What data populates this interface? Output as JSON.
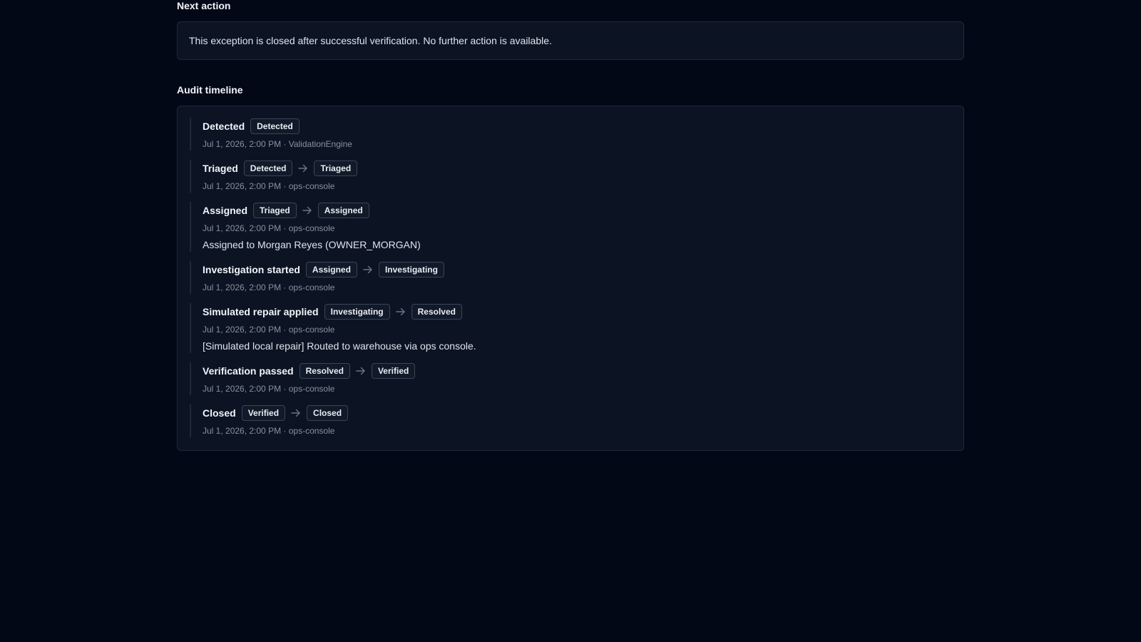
{
  "next_action": {
    "title": "Next action",
    "message": "This exception is closed after successful verification. No further action is available."
  },
  "audit": {
    "title": "Audit timeline",
    "events": [
      {
        "title": "Detected",
        "from": "",
        "to": "Detected",
        "meta": "Jul 1, 2026, 2:00 PM · ValidationEngine",
        "note": ""
      },
      {
        "title": "Triaged",
        "from": "Detected",
        "to": "Triaged",
        "meta": "Jul 1, 2026, 2:00 PM · ops-console",
        "note": ""
      },
      {
        "title": "Assigned",
        "from": "Triaged",
        "to": "Assigned",
        "meta": "Jul 1, 2026, 2:00 PM · ops-console",
        "note": "Assigned to Morgan Reyes (OWNER_MORGAN)"
      },
      {
        "title": "Investigation started",
        "from": "Assigned",
        "to": "Investigating",
        "meta": "Jul 1, 2026, 2:00 PM · ops-console",
        "note": ""
      },
      {
        "title": "Simulated repair applied",
        "from": "Investigating",
        "to": "Resolved",
        "meta": "Jul 1, 2026, 2:00 PM · ops-console",
        "note": "[Simulated local repair] Routed to warehouse via ops console."
      },
      {
        "title": "Verification passed",
        "from": "Resolved",
        "to": "Verified",
        "meta": "Jul 1, 2026, 2:00 PM · ops-console",
        "note": ""
      },
      {
        "title": "Closed",
        "from": "Verified",
        "to": "Closed",
        "meta": "Jul 1, 2026, 2:00 PM · ops-console",
        "note": ""
      }
    ]
  },
  "icons": {
    "transition": "arrow-right-icon"
  },
  "colors": {
    "background": "#030817",
    "card": "#0c1423",
    "border": "#1e2838",
    "muted_text": "#8891a1"
  }
}
